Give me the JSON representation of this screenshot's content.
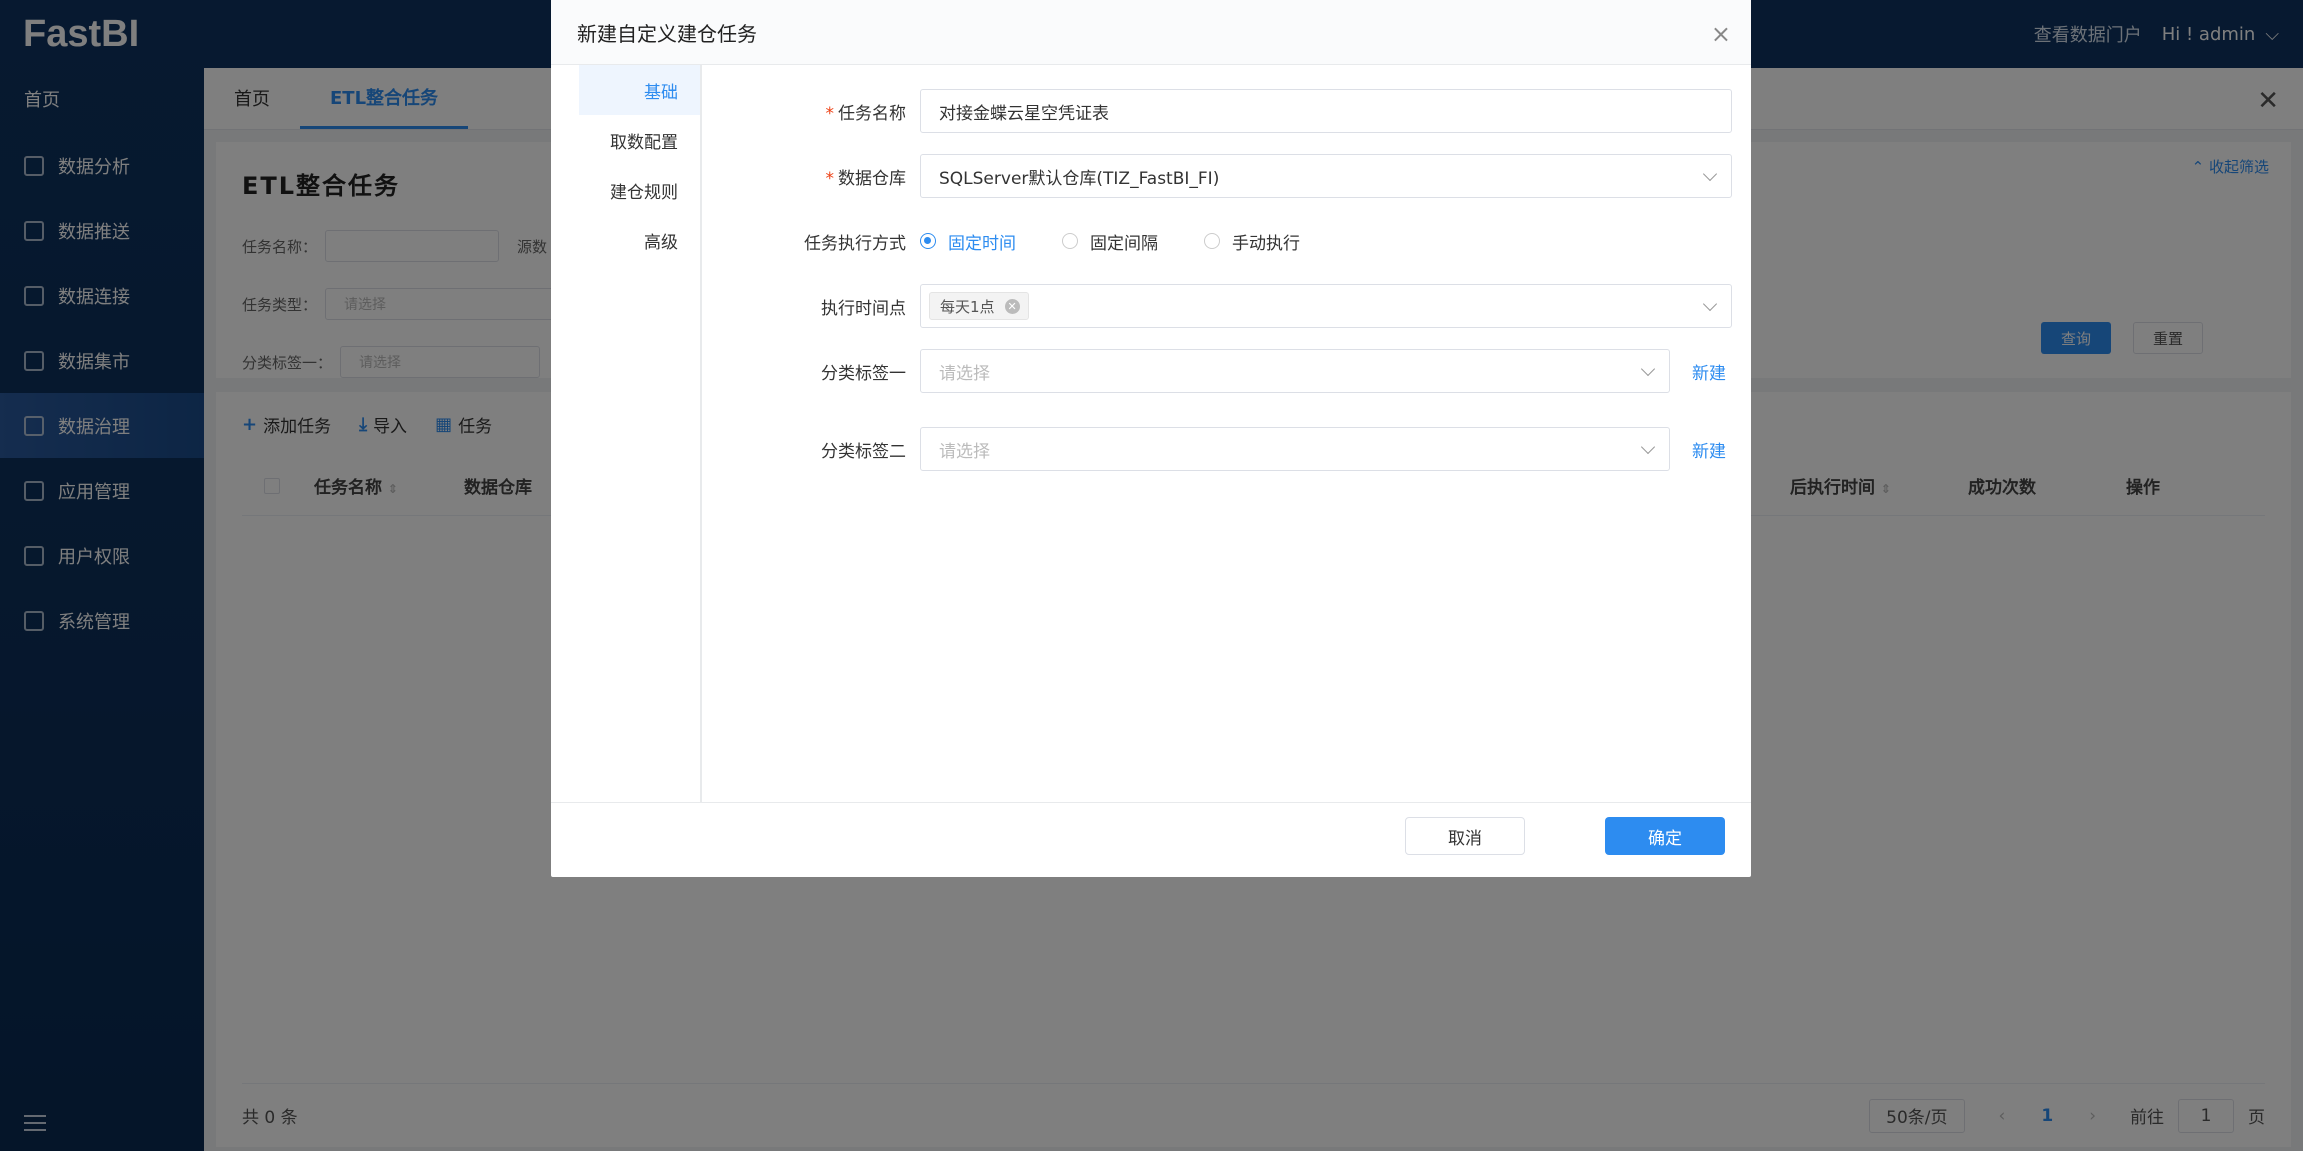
{
  "app": {
    "logo": "FastBI"
  },
  "topbar": {
    "portal_link": "查看数据门户",
    "greeting": "Hi ! admin"
  },
  "sidebar": {
    "home": "首页",
    "items": [
      {
        "label": "数据分析",
        "icon": "analysis-icon"
      },
      {
        "label": "数据推送",
        "icon": "push-icon"
      },
      {
        "label": "数据连接",
        "icon": "connection-icon"
      },
      {
        "label": "数据集市",
        "icon": "mart-icon"
      },
      {
        "label": "数据治理",
        "icon": "governance-icon",
        "active": true
      },
      {
        "label": "应用管理",
        "icon": "apps-icon"
      },
      {
        "label": "用户权限",
        "icon": "users-icon"
      },
      {
        "label": "系统管理",
        "icon": "system-icon"
      }
    ]
  },
  "tabs": [
    {
      "label": "首页"
    },
    {
      "label": "ETL整合任务",
      "active": true
    }
  ],
  "page": {
    "title": "ETL整合任务",
    "filters": {
      "task_name_label": "任务名称：",
      "source_label": "源数",
      "task_type_label": "任务类型：",
      "task_type_placeholder": "请选择",
      "tag1_label": "分类标签一：",
      "tag1_placeholder": "请选择",
      "collapse": "收起筛选",
      "query_button": "查询",
      "reset_button": "重置"
    },
    "toolbar": {
      "add": "添加任务",
      "import": "导入",
      "group": "任务"
    },
    "table_headers": [
      "任务名称",
      "数据仓库",
      "后执行时间",
      "成功次数",
      "操作"
    ],
    "footer": {
      "total": "共 0 条",
      "page_size": "50条/页",
      "current_page": "1",
      "goto_label": "前往",
      "goto_value": "1",
      "page_unit": "页"
    }
  },
  "dialog": {
    "title": "新建自定义建仓任务",
    "nav": [
      {
        "label": "基础",
        "active": true
      },
      {
        "label": "取数配置"
      },
      {
        "label": "建仓规则"
      },
      {
        "label": "高级"
      }
    ],
    "fields": {
      "task_name": {
        "label": "任务名称",
        "value": "对接金蝶云星空凭证表"
      },
      "warehouse": {
        "label": "数据仓库",
        "value": "SQLServer默认仓库(TIZ_FastBI_FI)"
      },
      "exec_mode": {
        "label": "任务执行方式",
        "options": [
          "固定时间",
          "固定间隔",
          "手动执行"
        ],
        "selected": "固定时间"
      },
      "exec_time": {
        "label": "执行时间点",
        "tag": "每天1点"
      },
      "tag1": {
        "label": "分类标签一",
        "placeholder": "请选择",
        "new_link": "新建"
      },
      "tag2": {
        "label": "分类标签二",
        "placeholder": "请选择",
        "new_link": "新建"
      }
    },
    "cancel_button": "取消",
    "ok_button": "确定"
  },
  "colors": {
    "primary": "#2d8cf0",
    "sidebar": "#0e3360",
    "required": "#ed4014"
  }
}
